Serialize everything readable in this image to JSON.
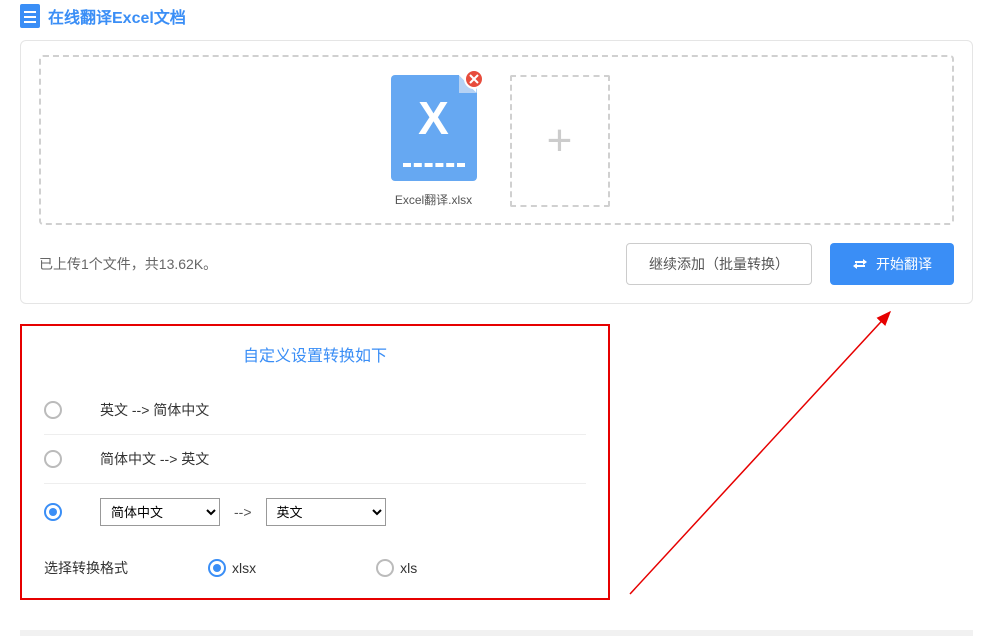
{
  "title": "在线翻译Excel文档",
  "file": {
    "name": "Excel翻译.xlsx",
    "thumb_letter": "X"
  },
  "status_text": "已上传1个文件，共13.62K。",
  "buttons": {
    "add_more": "继续添加（批量转换）",
    "start": "开始翻译"
  },
  "settings": {
    "heading": "自定义设置转换如下",
    "options": [
      {
        "label": "英文 --> 简体中文",
        "checked": false
      },
      {
        "label": "简体中文 --> 英文",
        "checked": false
      }
    ],
    "custom": {
      "checked": true,
      "from_selected": "简体中文",
      "to_selected": "英文",
      "arrow": "-->"
    },
    "format_label": "选择转换格式",
    "formats": [
      {
        "label": "xlsx",
        "checked": true
      },
      {
        "label": "xls",
        "checked": false
      }
    ]
  }
}
